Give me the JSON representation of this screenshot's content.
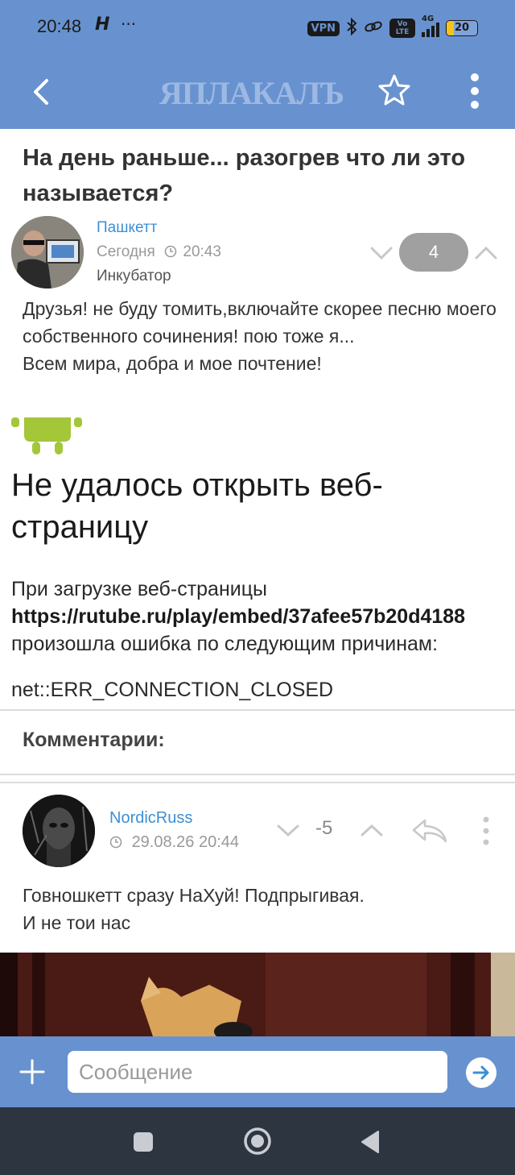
{
  "status_bar": {
    "time": "20:48",
    "h_icon": "H",
    "dots": "···",
    "vpn": "VPN",
    "volte": "Vo LTE",
    "network": "4G",
    "battery": "20"
  },
  "app_bar": {
    "logo": "ЯПЛАКАЛЪ",
    "icons": [
      "back-arrow-icon",
      "star-icon",
      "more-vertical-icon"
    ]
  },
  "post": {
    "title": "На день раньше... разогрев что ли это называется?",
    "author": "Пашкетт",
    "date": "Сегодня",
    "time": "20:43",
    "rank": "Инкубатор",
    "votes": "4",
    "body": [
      "Друзья! не буду томить,включайте скорее песню моего собственного сочинения! пою тоже я...",
      "Всем мира, добра и мое почтение!"
    ]
  },
  "embed_error": {
    "title": "Не удалось открыть веб-страницу",
    "line1": "При загрузке веб-страницы",
    "url": "https://rutube.ru/play/embed/37afee57b20d4188",
    "line3": "произошла ошибка по следующим причинам:",
    "code": "net::ERR_CONNECTION_CLOSED"
  },
  "comments": {
    "header": "Комментарии:",
    "items": [
      {
        "author": "NordicRuss",
        "date": "29.08.26 20:44",
        "score": "-5",
        "body": [
          "Говношкетт сразу НаХуй! Подпрыгивая.",
          "И не тои нас"
        ]
      }
    ]
  },
  "composer": {
    "placeholder": "Сообщение"
  },
  "colors": {
    "bar": "#6892cf",
    "link": "#3d8fd4",
    "navbar": "#2d3541"
  }
}
